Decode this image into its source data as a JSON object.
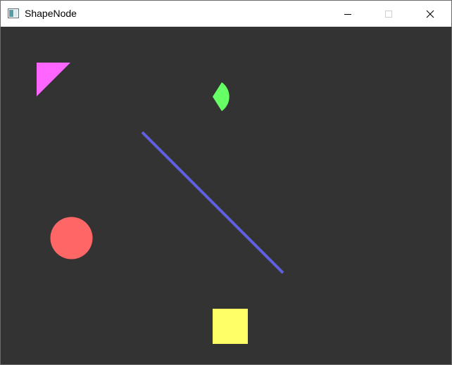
{
  "window": {
    "title": "ShapeNode",
    "controls": [
      "minimize",
      "maximize",
      "close"
    ],
    "title_icon": "window-app-icon",
    "minimize_icon": "minimize-icon",
    "maximize_icon": "maximize-icon",
    "close_icon": "close-icon"
  },
  "canvas": {
    "background": "#333333",
    "shapes": [
      {
        "kind": "triangle",
        "color": "#ff66ff"
      },
      {
        "kind": "pie-wedge",
        "color": "#66ff66"
      },
      {
        "kind": "line",
        "color": "#6060e0"
      },
      {
        "kind": "circle",
        "color": "#ff6666"
      },
      {
        "kind": "square",
        "color": "#ffff66"
      }
    ]
  }
}
